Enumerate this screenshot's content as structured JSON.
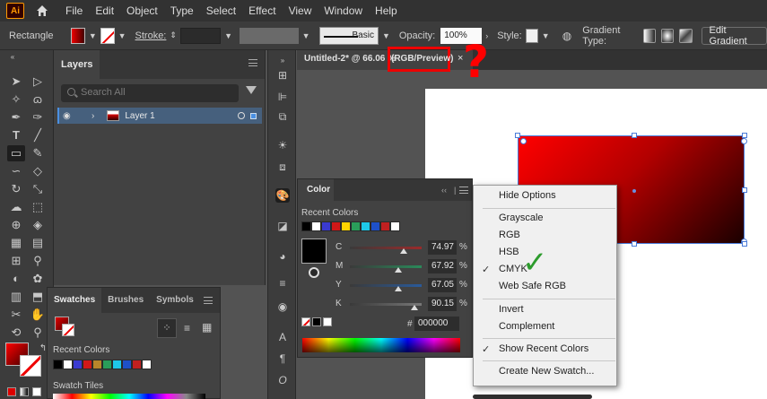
{
  "app": {
    "logo": "Ai",
    "home_icon": "home-icon"
  },
  "menubar": {
    "items": [
      "File",
      "Edit",
      "Object",
      "Type",
      "Select",
      "Effect",
      "View",
      "Window",
      "Help"
    ]
  },
  "control_bar": {
    "tool_name": "Rectangle",
    "stroke_label": "Stroke:",
    "brush_preset": "Basic",
    "opacity_label": "Opacity:",
    "opacity_value": "100%",
    "style_label": "Style:",
    "gradient_type_label": "Gradient Type:",
    "edit_gradient_label": "Edit Gradient"
  },
  "layers_panel": {
    "tab": "Layers",
    "search_placeholder": "Search All",
    "layer_name": "Layer 1"
  },
  "document": {
    "tab_title": "Untitled-2* @ 66.06 %",
    "mode": "(RGB/Preview)",
    "close": "×",
    "annotation": "?"
  },
  "color_panel": {
    "tab": "Color",
    "recent_label": "Recent Colors",
    "channels": [
      {
        "label": "C",
        "value": "74.97",
        "fraction": 0.7497,
        "track": "#9a2a2a"
      },
      {
        "label": "M",
        "value": "67.92",
        "fraction": 0.6792,
        "track": "#2a8a5a"
      },
      {
        "label": "Y",
        "value": "67.05",
        "fraction": 0.6705,
        "track": "#2a5a9a"
      },
      {
        "label": "K",
        "value": "90.15",
        "fraction": 0.9015,
        "track": "#777777"
      }
    ],
    "unit": "%",
    "hex_symbol": "#",
    "hex": "000000",
    "recent_colors": [
      "#000000",
      "#ffffff",
      "#3a3ad0",
      "#d01818",
      "#ffd400",
      "#2a9d5a",
      "#1ec8e8",
      "#1e50c8",
      "#c02020",
      "#ffffff"
    ]
  },
  "flyout_menu": {
    "items": [
      {
        "label": "Hide Options",
        "checked": false
      },
      {
        "label": "Grayscale",
        "checked": false
      },
      {
        "label": "RGB",
        "checked": false
      },
      {
        "label": "HSB",
        "checked": false
      },
      {
        "label": "CMYK",
        "checked": true
      },
      {
        "label": "Web Safe RGB",
        "checked": false
      },
      {
        "label": "Invert",
        "checked": false
      },
      {
        "label": "Complement",
        "checked": false
      },
      {
        "label": "Show Recent Colors",
        "checked": true
      },
      {
        "label": "Create New Swatch...",
        "checked": false
      }
    ],
    "annotation_check": "✓"
  },
  "swatches_panel": {
    "tabs": [
      "Swatches",
      "Brushes",
      "Symbols"
    ],
    "recent_label": "Recent Colors",
    "tiles_label": "Swatch Tiles",
    "recent_colors": [
      "#000000",
      "#ffffff",
      "#3a3ad0",
      "#d01818",
      "#b8862a",
      "#2a9d5a",
      "#1ec8e8",
      "#1e50c8",
      "#c02020",
      "#ffffff"
    ]
  },
  "colors": {
    "accent": "#4a90e2",
    "annotation": "#ff0000",
    "check": "#2d9c2d"
  }
}
